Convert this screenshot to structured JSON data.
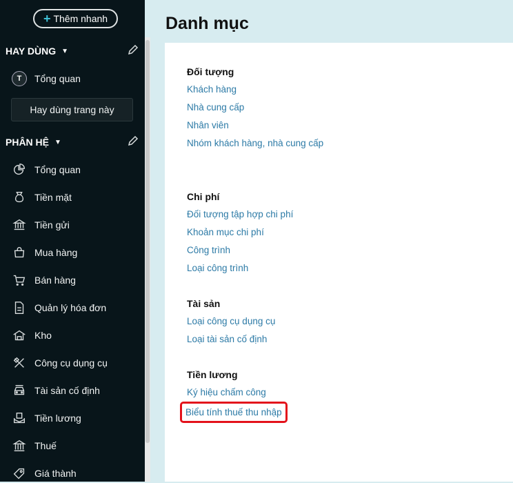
{
  "sidebar": {
    "quick_add": "Thêm nhanh",
    "favorites_title": "HAY DÙNG",
    "favorites": [
      {
        "initial": "T",
        "label": "Tổng quan"
      }
    ],
    "add_favorite": "Hay dùng trang này",
    "modules_title": "PHÂN HỆ",
    "modules": [
      {
        "label": "Tổng quan",
        "icon": "pie-chart-icon"
      },
      {
        "label": "Tiền mặt",
        "icon": "money-bag-icon"
      },
      {
        "label": "Tiền gửi",
        "icon": "bank-icon"
      },
      {
        "label": "Mua hàng",
        "icon": "shopping-bag-icon"
      },
      {
        "label": "Bán hàng",
        "icon": "cart-icon"
      },
      {
        "label": "Quản lý hóa đơn",
        "icon": "invoice-icon"
      },
      {
        "label": "Kho",
        "icon": "warehouse-icon"
      },
      {
        "label": "Công cụ dụng cụ",
        "icon": "tools-icon"
      },
      {
        "label": "Tài sản cố định",
        "icon": "car-icon"
      },
      {
        "label": "Tiền lương",
        "icon": "salary-icon"
      },
      {
        "label": "Thuế",
        "icon": "tax-building-icon"
      },
      {
        "label": "Giá thành",
        "icon": "price-tag-icon"
      }
    ]
  },
  "main": {
    "title": "Danh mục",
    "groups": [
      {
        "title": "Đối tượng",
        "links": [
          "Khách hàng",
          "Nhà cung cấp",
          "Nhân viên",
          "Nhóm khách hàng, nhà cung cấp"
        ]
      },
      {
        "title": "Chi phí",
        "links": [
          "Đối tượng tập hợp chi phí",
          "Khoản mục chi phí",
          "Công trình",
          "Loại công trình"
        ]
      },
      {
        "title": "Tài sản",
        "links": [
          "Loại công cụ dụng cụ",
          "Loại tài sản cố định"
        ]
      },
      {
        "title": "Tiền lương",
        "links": [
          "Ký hiệu chấm công",
          "Biểu tính thuế thu nhập"
        ]
      }
    ],
    "highlight_color": "#e3121b"
  }
}
